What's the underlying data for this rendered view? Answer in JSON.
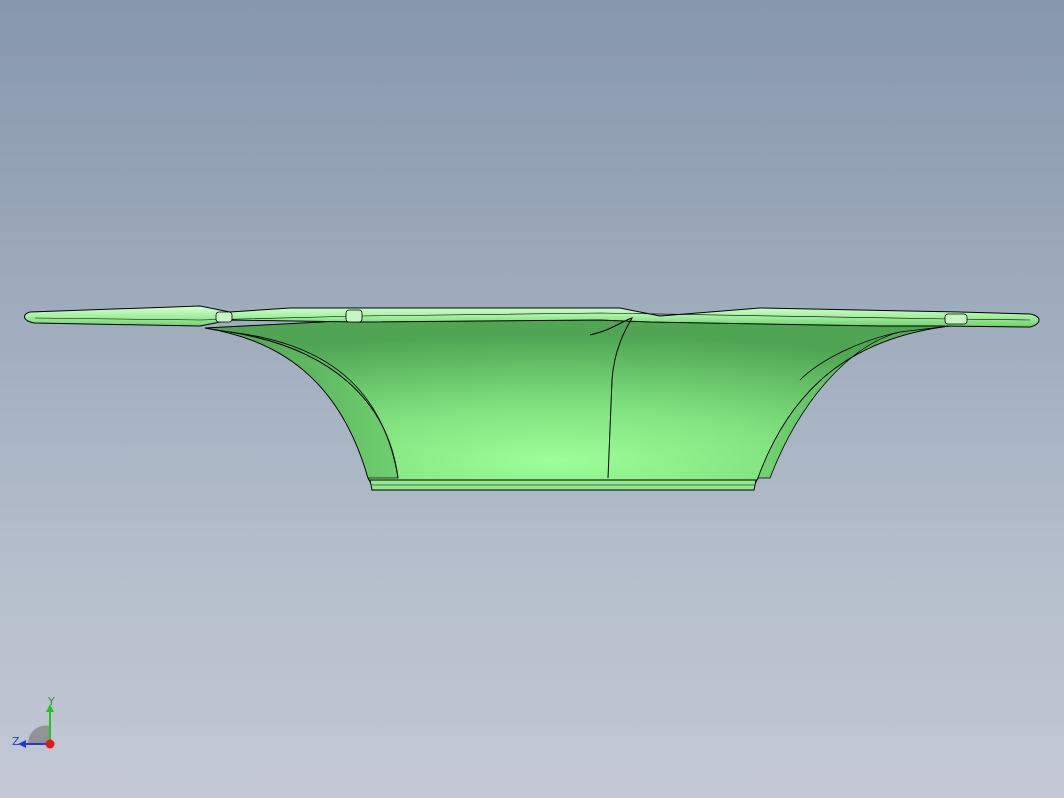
{
  "viewport": {
    "background_top": "#8797ac",
    "background_bottom": "#c3c8d4"
  },
  "model": {
    "part_color": "#79e07a",
    "part_shadow_color": "#4fae52",
    "part_highlight_color": "#9dff98",
    "edge_color": "#000000"
  },
  "triad": {
    "y_label": "Y",
    "z_label": "Z",
    "y_color": "#22c41f",
    "z_color": "#2a38c8",
    "x_color": "#e01818"
  }
}
